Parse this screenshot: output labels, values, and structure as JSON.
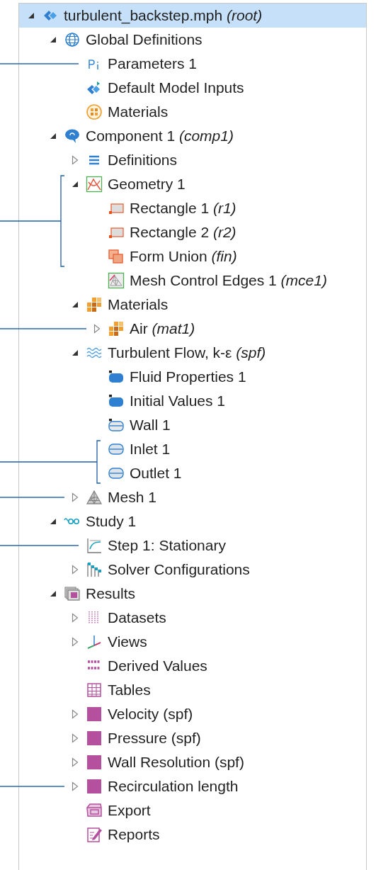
{
  "tree": [
    {
      "label": "turbulent_backstep.mph *(root)*",
      "selected": true,
      "expanded": true,
      "children": [
        {
          "label": "Global Definitions",
          "selected": false,
          "expanded": true,
          "children": [
            {
              "label": "Parameters 1",
              "selected": false,
              "leader_line": true
            },
            {
              "label": "Default Model Inputs",
              "selected": false
            },
            {
              "label": "Materials",
              "selected": false
            }
          ]
        },
        {
          "label": "Component 1 *(comp1)*",
          "selected": false,
          "expanded": true,
          "children": [
            {
              "label": "Definitions",
              "selected": false,
              "expanded": false
            },
            {
              "label": "Geometry 1",
              "selected": false,
              "expanded": true,
              "bracketed": true,
              "children": [
                {
                  "label": "Rectangle 1 *(r1)*",
                  "selected": false,
                  "bracketed": true
                },
                {
                  "label": "Rectangle 2 *(r2)*",
                  "selected": false,
                  "bracketed": true
                },
                {
                  "label": "Form Union *(fin)*",
                  "selected": false,
                  "bracketed": true
                },
                {
                  "label": "Mesh Control Edges 1 *(mce1)*",
                  "selected": false
                }
              ]
            },
            {
              "label": "Materials",
              "selected": false,
              "expanded": true,
              "children": [
                {
                  "label": "Air *(mat1)*",
                  "selected": false,
                  "expanded": false,
                  "leader_line": true
                }
              ]
            },
            {
              "label": "Turbulent Flow, k-ε *(spf)*",
              "selected": false,
              "expanded": true,
              "children": [
                {
                  "label": "Fluid Properties 1",
                  "selected": false
                },
                {
                  "label": "Initial Values 1",
                  "selected": false
                },
                {
                  "label": "Wall 1",
                  "selected": false
                },
                {
                  "label": "Inlet 1",
                  "selected": false,
                  "bracketed": true
                },
                {
                  "label": "Outlet 1",
                  "selected": false,
                  "bracketed": true
                }
              ]
            },
            {
              "label": "Mesh 1",
              "selected": false,
              "expanded": false,
              "leader_line": true
            }
          ]
        },
        {
          "label": "Study 1",
          "selected": false,
          "expanded": true,
          "children": [
            {
              "label": "Step 1: Stationary",
              "selected": false,
              "leader_line": true
            },
            {
              "label": "Solver Configurations",
              "selected": false,
              "expanded": false
            }
          ]
        },
        {
          "label": "Results",
          "selected": false,
          "expanded": true,
          "children": [
            {
              "label": "Datasets",
              "selected": false,
              "expanded": false
            },
            {
              "label": "Views",
              "selected": false,
              "expanded": false
            },
            {
              "label": "Derived Values",
              "selected": false
            },
            {
              "label": "Tables",
              "selected": false
            },
            {
              "label": "Velocity (spf)",
              "selected": false,
              "expanded": false
            },
            {
              "label": "Pressure (spf)",
              "selected": false,
              "expanded": false
            },
            {
              "label": "Wall Resolution (spf)",
              "selected": false,
              "expanded": false
            },
            {
              "label": "Recirculation length",
              "selected": false,
              "expanded": false,
              "leader_line": true
            },
            {
              "label": "Export",
              "selected": false
            },
            {
              "label": "Reports",
              "selected": false
            }
          ]
        }
      ]
    }
  ]
}
